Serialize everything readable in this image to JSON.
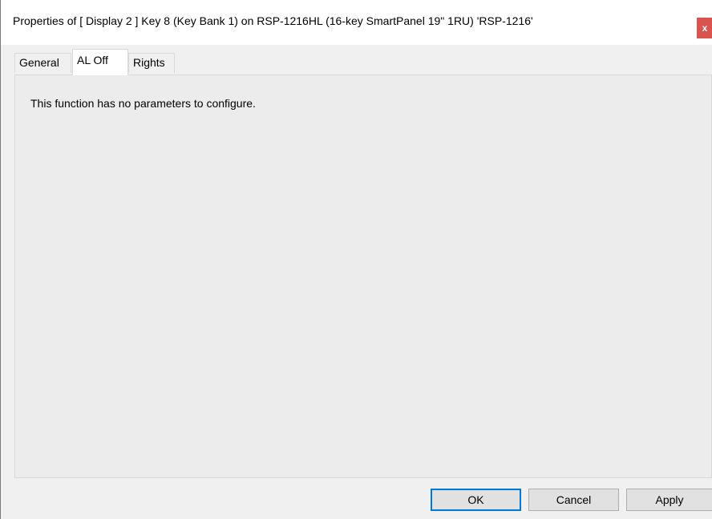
{
  "window": {
    "title": "Properties of [ Display 2 ] Key 8 (Key Bank 1) on RSP-1216HL (16-key SmartPanel 19\" 1RU) 'RSP-1216'",
    "close_label": "x"
  },
  "tabs": [
    {
      "label": "General"
    },
    {
      "label": "AL Off"
    },
    {
      "label": "Rights"
    }
  ],
  "active_tab": "AL Off",
  "panel": {
    "message": "This function has no parameters to configure."
  },
  "buttons": {
    "ok": "OK",
    "cancel": "Cancel",
    "apply": "Apply"
  },
  "colors": {
    "close_button": "#d9534f",
    "default_button_border": "#0078d7"
  }
}
